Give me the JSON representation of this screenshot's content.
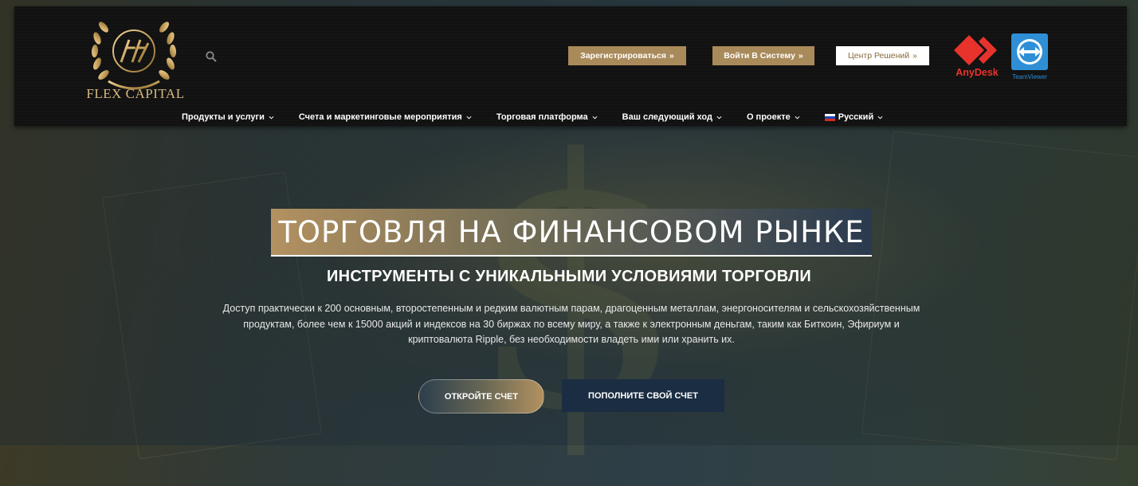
{
  "brand": {
    "name": "FLEX CAPITAL"
  },
  "header": {
    "buttons": {
      "register": "Зарегистрироваться",
      "login": "Войти В Систему",
      "solutions": "Центр Решений",
      "arrow": "»"
    },
    "apps": {
      "anydesk": "AnyDesk",
      "teamviewer": "TeamViewer"
    }
  },
  "nav": {
    "items": [
      {
        "label": "Продукты и услуги"
      },
      {
        "label": "Счета и маркетинговые мероприятия"
      },
      {
        "label": "Торговая платформа"
      },
      {
        "label": "Ваш следующий ход"
      },
      {
        "label": "О проекте"
      },
      {
        "label": "Русский"
      }
    ]
  },
  "hero": {
    "title": "ТОРГОВЛЯ НА ФИНАНСОВОМ РЫНКЕ",
    "subtitle": "ИНСТРУМЕНТЫ С УНИКАЛЬНЫМИ УСЛОВИЯМИ ТОРГОВЛИ",
    "description": "Доступ практически к 200 основным, второстепенным и редким валютным парам, драгоценным металлам, энергоносителям и сельскохозяйственным продуктам, более чем к 15000 акций и индексов на 30 биржах по всему миру, а также к электронным деньгам, таким как Биткоин, Эфириум и криптовалюта Ripple, без необходимости владеть ими или хранить их.",
    "cta_open": "ОТКРОЙТЕ СЧЕТ",
    "cta_fund": "ПОПОЛНИТЕ СВОЙ СЧЕТ"
  },
  "colors": {
    "gold": "#a98a5a",
    "navy": "#1a2d42",
    "anydesk_red": "#e8332c",
    "teamviewer_blue": "#2f8fd6"
  },
  "icons": {
    "search": "search-icon",
    "chevron": "chevron-down-icon",
    "flag": "russia-flag-icon",
    "logo": "laurel-wreath-logo"
  }
}
